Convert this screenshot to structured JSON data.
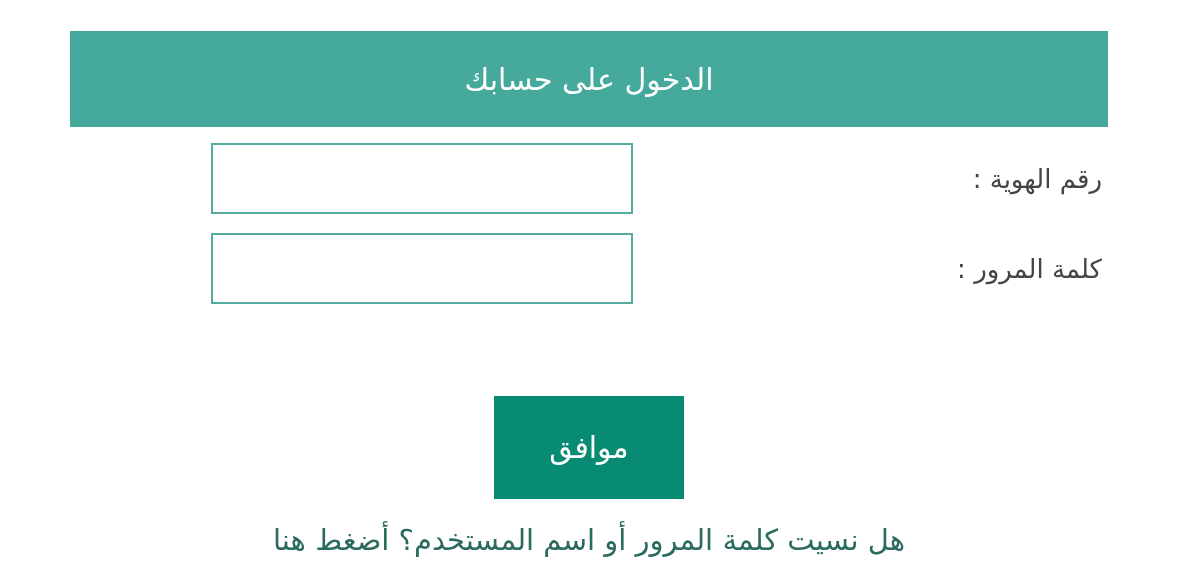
{
  "header": {
    "title": "الدخول على حسابك"
  },
  "fields": [
    {
      "label": "رقم الهوية :"
    },
    {
      "label": "كلمة المرور :"
    }
  ],
  "submit_button": "موافق",
  "forgot_link": "هل نسيت كلمة المرور أو اسم المستخدم؟ أضغط هنا"
}
